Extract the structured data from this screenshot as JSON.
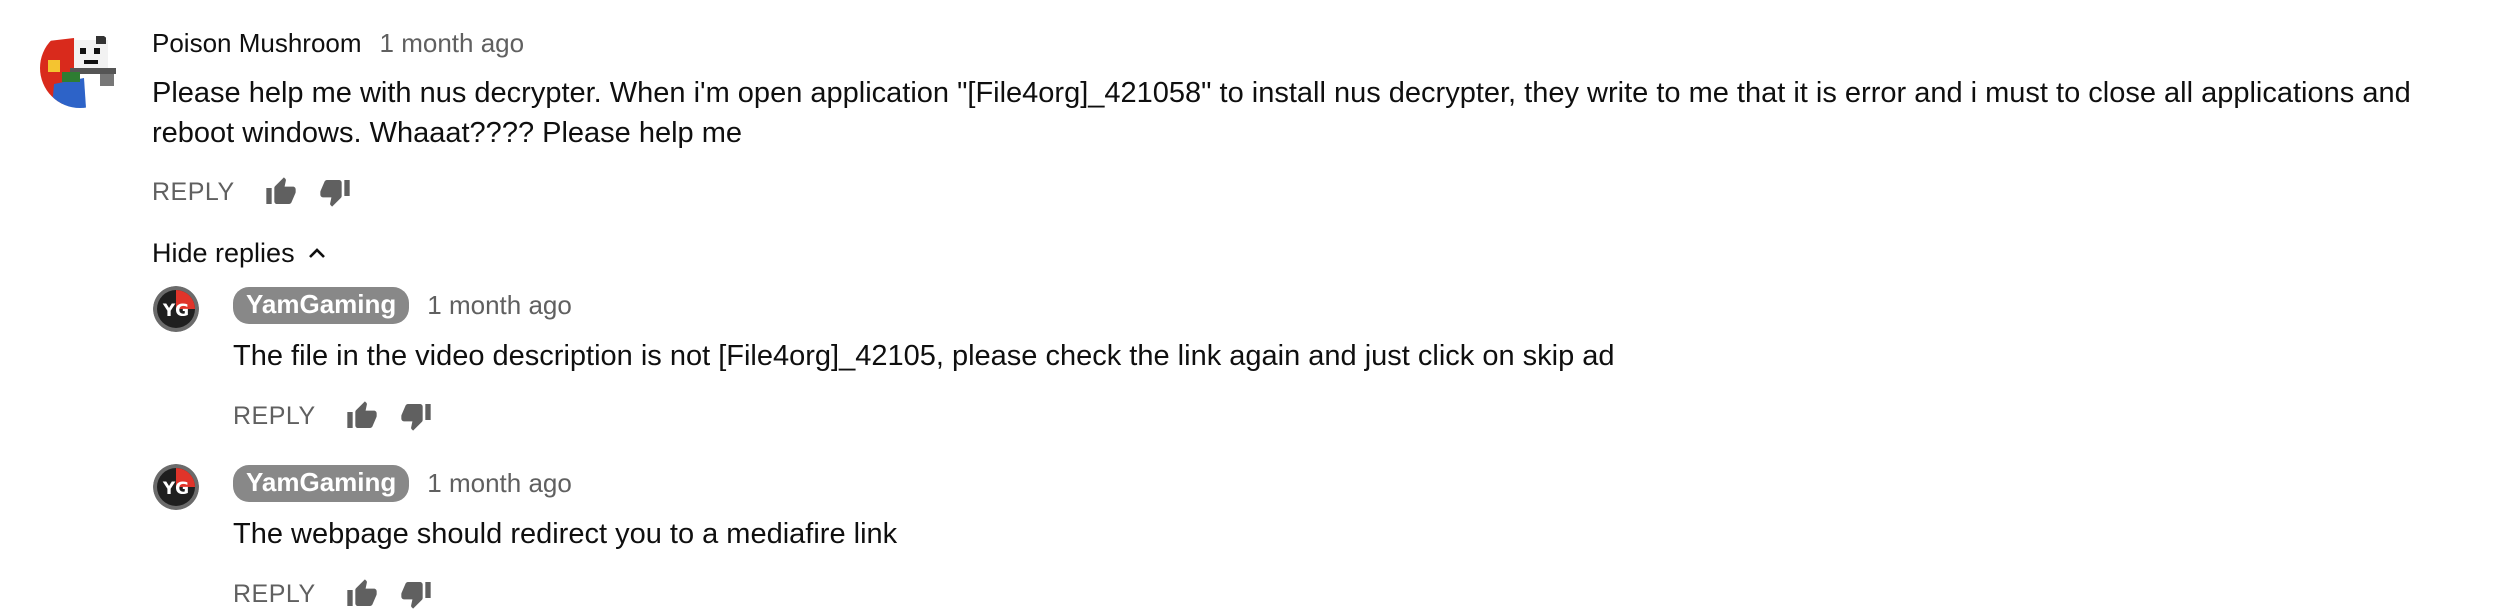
{
  "comment": {
    "author": "Poison Mushroom",
    "time": "1 month ago",
    "text": "Please help me with nus decrypter. When i'm open application \"[File4org]_421058\" to install nus decrypter, they write to me that it is error and i must to close all applications and reboot windows. Whaaat???? Please help me",
    "reply_label": "REPLY"
  },
  "replies_toggle": {
    "label": "Hide replies",
    "icon": "chevron-up-icon"
  },
  "replies": [
    {
      "author": "YamGaming",
      "time": "1 month ago",
      "text": "The file in the video description is not [File4org]_42105, please check the link again and just click on skip ad",
      "reply_label": "REPLY"
    },
    {
      "author": "YamGaming",
      "time": "1 month ago",
      "text": "The webpage should redirect you to a mediafire link",
      "reply_label": "REPLY"
    }
  ],
  "colors": {
    "author_chip": "#888888",
    "secondary_text": "#606060",
    "primary_text": "#0f0f0f"
  }
}
